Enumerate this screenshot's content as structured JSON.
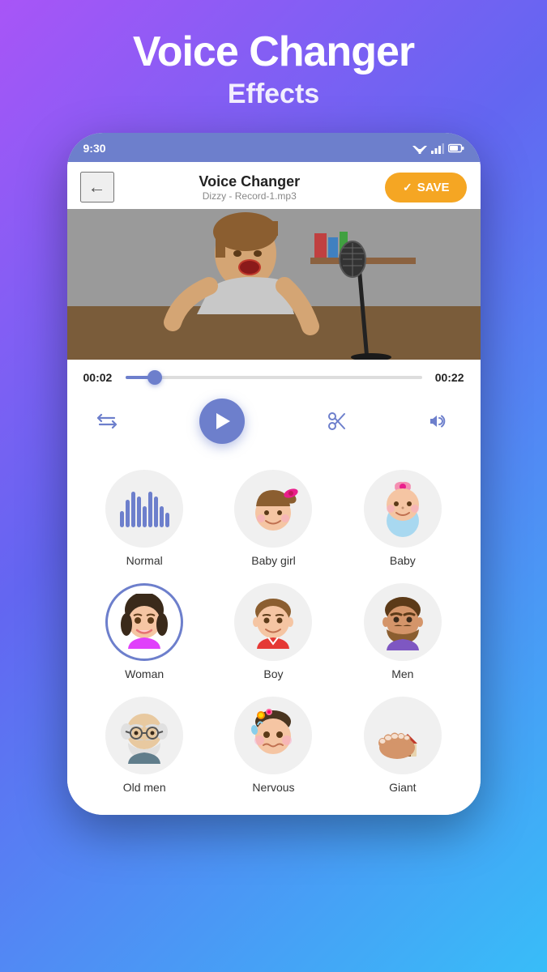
{
  "hero": {
    "title": "Voice Changer",
    "subtitle": "Effects"
  },
  "status_bar": {
    "time": "9:30",
    "wifi": "▼",
    "signal": "▲",
    "battery": "🔋"
  },
  "header": {
    "back_label": "←",
    "title": "Voice Changer",
    "subtitle": "Dizzy - Record-1.mp3",
    "save_label": "SAVE"
  },
  "player": {
    "time_current": "00:02",
    "time_total": "00:22",
    "progress_pct": 10
  },
  "effects": [
    {
      "id": "normal",
      "label": "Normal",
      "selected": false,
      "type": "waveform"
    },
    {
      "id": "baby-girl",
      "label": "Baby girl",
      "selected": false,
      "type": "emoji"
    },
    {
      "id": "baby",
      "label": "Baby",
      "selected": false,
      "type": "emoji"
    },
    {
      "id": "woman",
      "label": "Woman",
      "selected": true,
      "type": "emoji"
    },
    {
      "id": "boy",
      "label": "Boy",
      "selected": false,
      "type": "emoji"
    },
    {
      "id": "men",
      "label": "Men",
      "selected": false,
      "type": "emoji"
    },
    {
      "id": "old-men",
      "label": "Old men",
      "selected": false,
      "type": "emoji"
    },
    {
      "id": "nervous",
      "label": "Nervous",
      "selected": false,
      "type": "emoji"
    },
    {
      "id": "giant",
      "label": "Giant",
      "selected": false,
      "type": "emoji"
    }
  ],
  "colors": {
    "accent": "#6d7fcc",
    "save_bg": "#f5a623"
  }
}
